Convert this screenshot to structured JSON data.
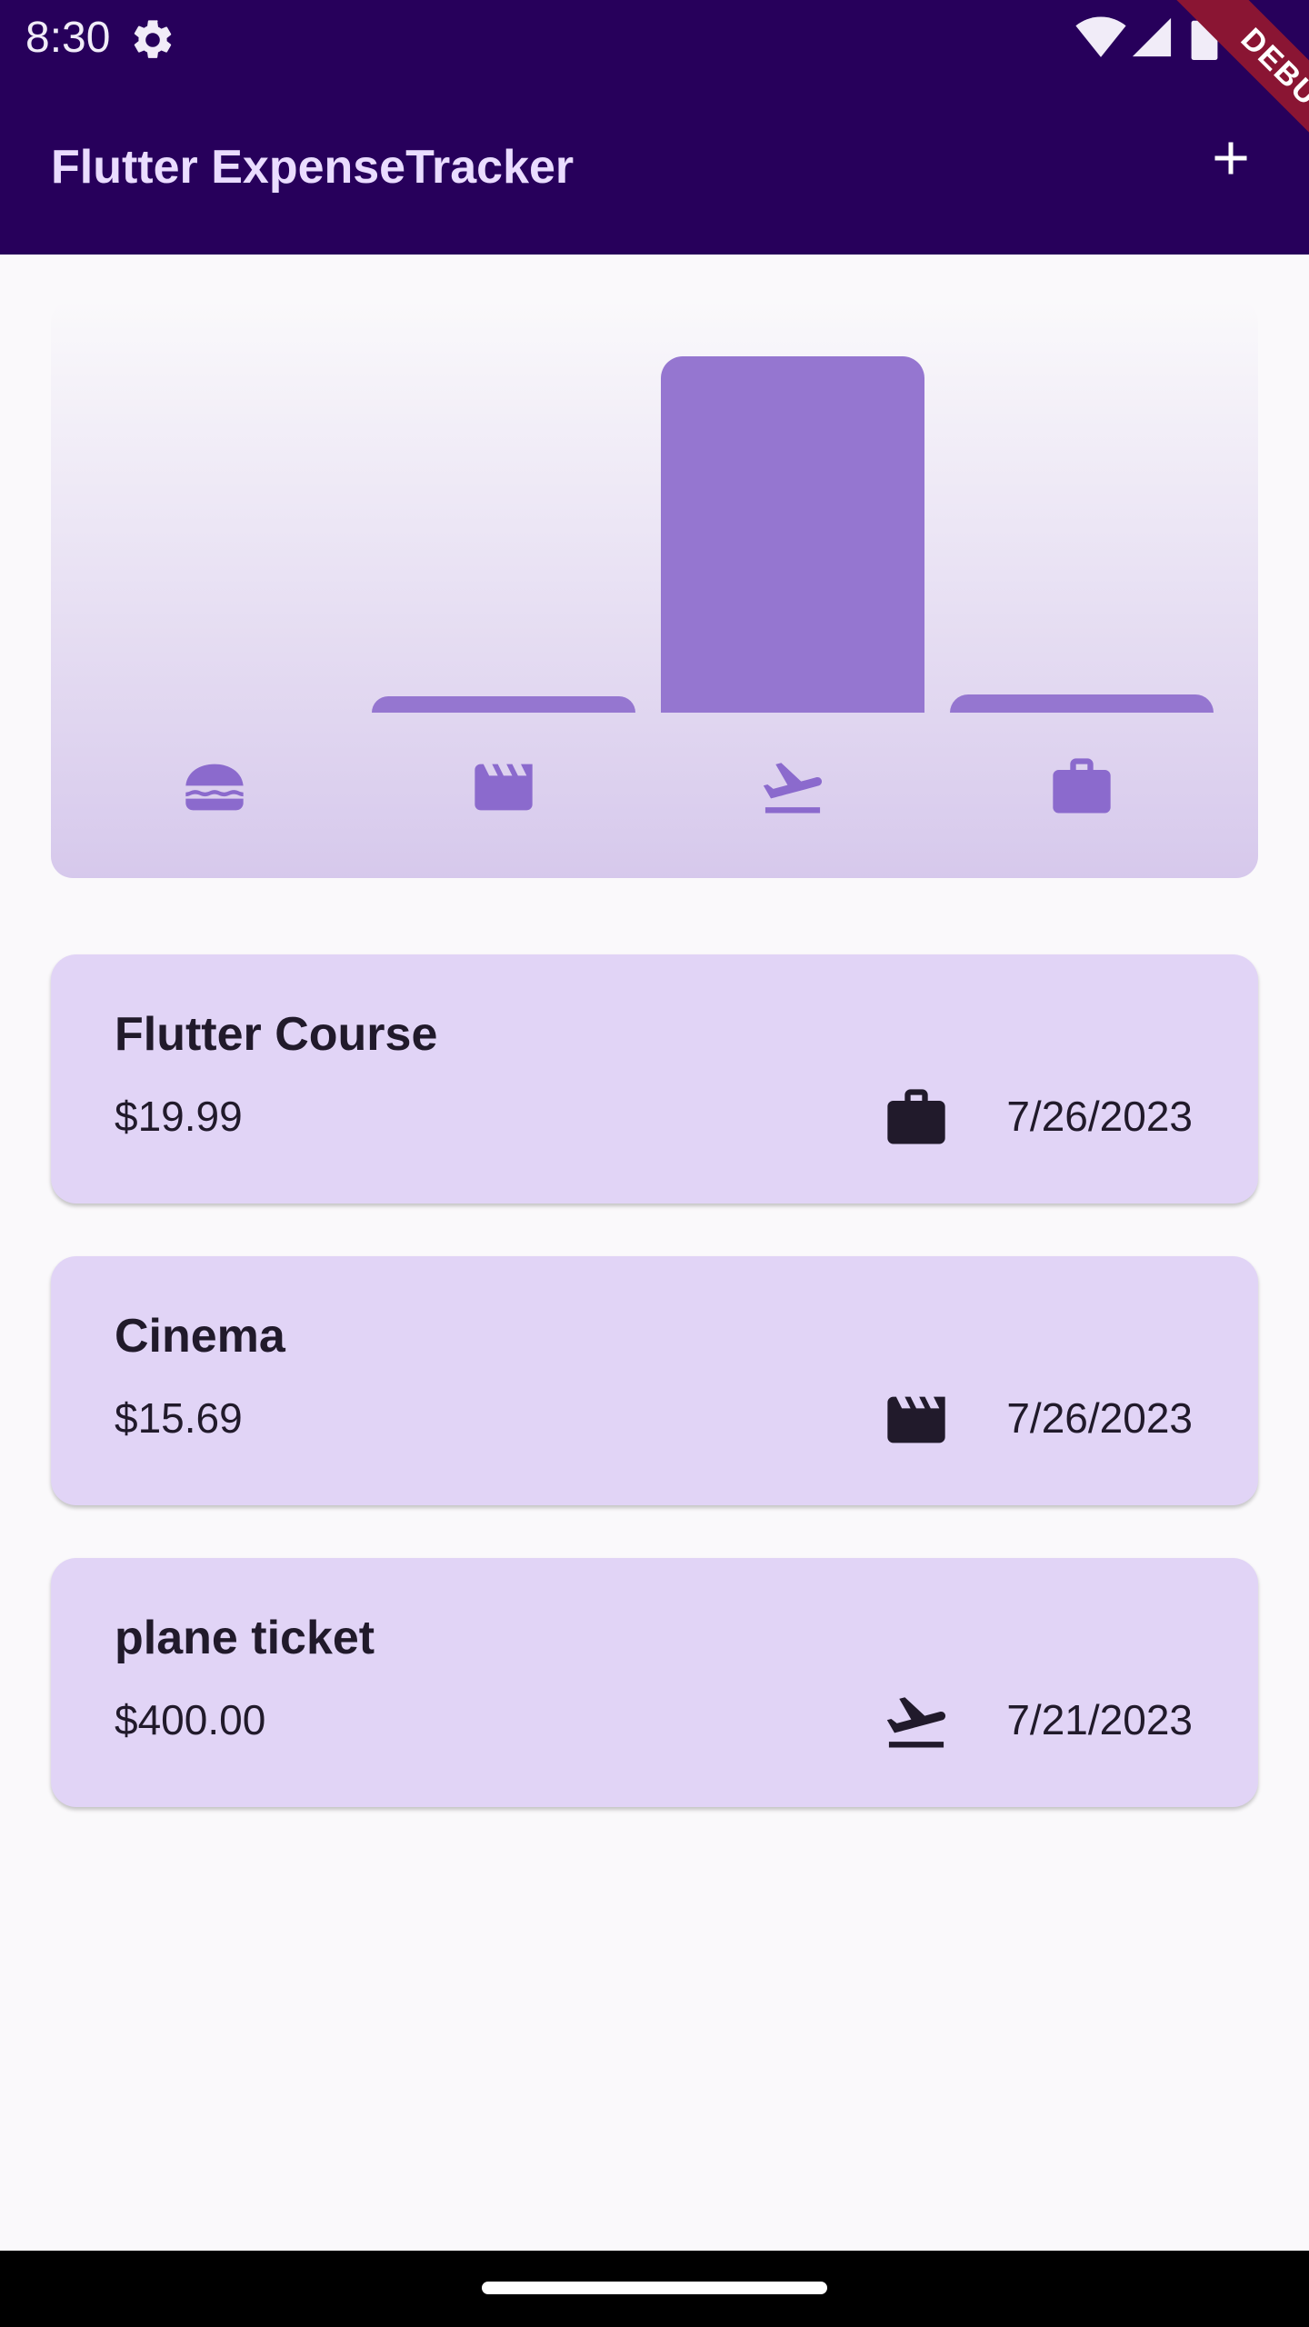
{
  "status_bar": {
    "time": "8:30"
  },
  "app_bar": {
    "title": "Flutter ExpenseTracker",
    "add_icon": "add-icon"
  },
  "debug_banner": {
    "label": "DEBUG"
  },
  "colors": {
    "app_bar_bg": "#27005b",
    "app_title": "#eadcff",
    "bar": "#9576d0",
    "category_icon": "#8b6acd",
    "card_bg": "#e1d4f6",
    "card_text": "#211a2b",
    "debug_ribbon": "#8a1533"
  },
  "chart_data": {
    "type": "bar",
    "categories": [
      "food",
      "leisure",
      "travel",
      "work"
    ],
    "category_icons": [
      "burger-icon",
      "clapperboard-icon",
      "flight-takeoff-icon",
      "briefcase-icon"
    ],
    "values": [
      0,
      15.69,
      400.0,
      19.99
    ],
    "ylim": [
      0,
      400
    ],
    "grid": false
  },
  "expenses": [
    {
      "title": "Flutter Course",
      "amount": "$19.99",
      "date": "7/26/2023",
      "category_icon": "briefcase-icon"
    },
    {
      "title": "Cinema",
      "amount": "$15.69",
      "date": "7/26/2023",
      "category_icon": "clapperboard-icon"
    },
    {
      "title": "plane ticket",
      "amount": "$400.00",
      "date": "7/21/2023",
      "category_icon": "flight-takeoff-icon"
    }
  ]
}
